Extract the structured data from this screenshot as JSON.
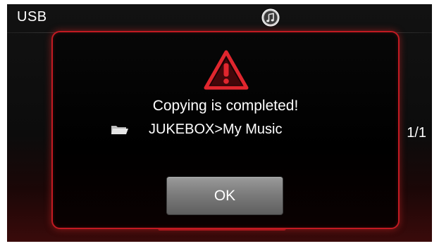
{
  "header": {
    "source_label": "USB",
    "center_icon": "music-note-icon"
  },
  "page_counter": "1/1",
  "dialog": {
    "icon": "warning-triangle-icon",
    "message": "Copying is completed!",
    "path_icon": "folder-icon",
    "path": "JUKEBOX>My Music",
    "ok_label": "OK"
  },
  "colors": {
    "accent_red": "#c21a22",
    "background": "#0c0c0c",
    "text": "#ffffff",
    "button_gray": "#7c7c7c"
  }
}
